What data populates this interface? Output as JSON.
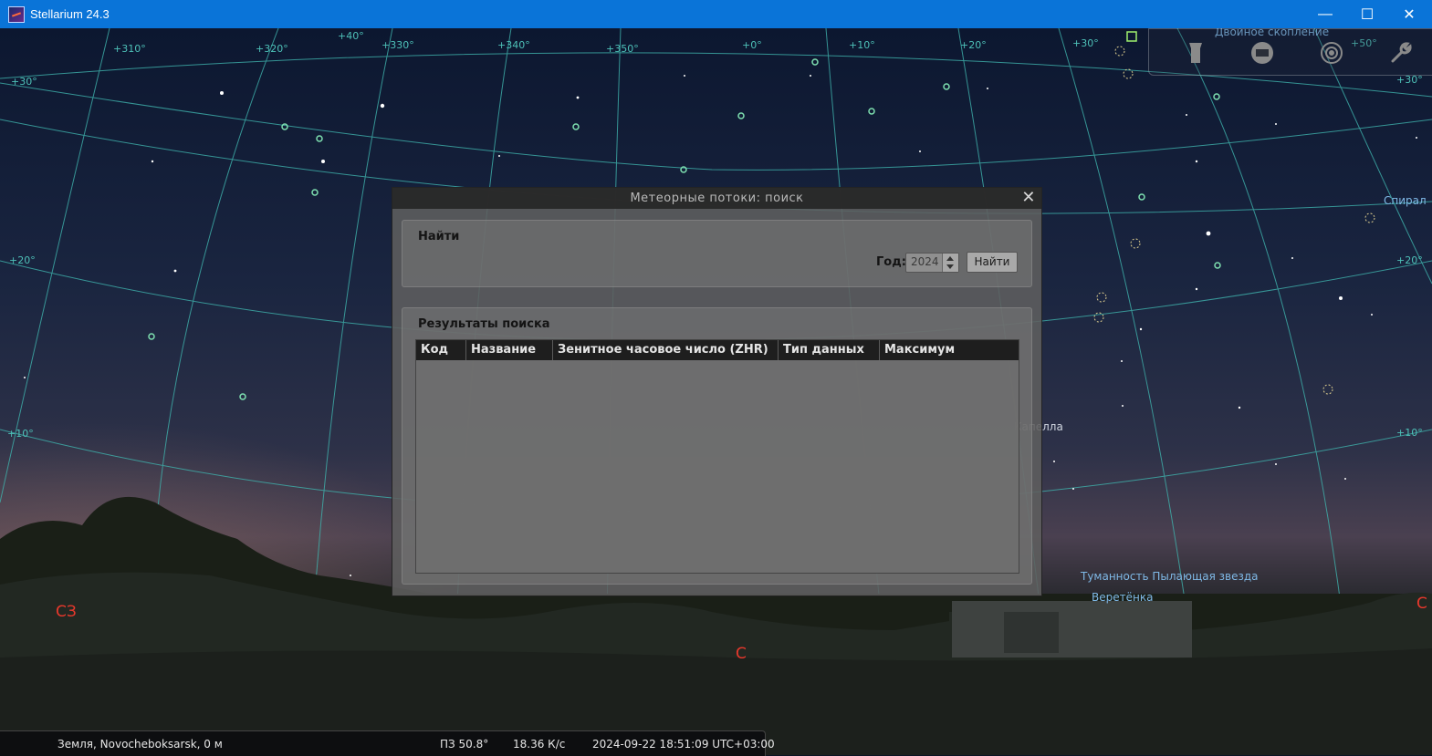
{
  "window": {
    "title": "Stellarium 24.3",
    "minimize": "—",
    "maximize": "☐",
    "close": "✕"
  },
  "sky_labels": {
    "double_cluster": "Двойное скопление",
    "spiral": "Спирал",
    "capella": "Капелла",
    "nebula": "Туманность Пылающая звезда",
    "ghost_label": "Веретёнка",
    "grid": [
      "+310°",
      "+320°",
      "+330°",
      "+340°",
      "+350°",
      "+0°",
      "+10°",
      "+20°",
      "+30°",
      "+40°",
      "+50°",
      "+30°",
      "+20°",
      "+10°",
      "+30°",
      "+20°",
      "+10°",
      "+40°"
    ]
  },
  "compass": {
    "nw": "СЗ",
    "n": "С",
    "ne": "С"
  },
  "toolbar": {
    "icons": [
      "flashlight-icon",
      "screen-icon",
      "target-icon",
      "wrench-icon"
    ]
  },
  "dialog": {
    "title": "Метеорные потоки: поиск",
    "close": "✕",
    "find_group": "Найти",
    "year_label": "Год:",
    "year_value": "2024",
    "find_button": "Найти",
    "results_group": "Результаты поиска",
    "columns": [
      "Код",
      "Название",
      "Зенитное часовое число (ZHR)",
      "Тип данных",
      "Максимум"
    ]
  },
  "statusbar": {
    "location": "Земля, Novocheboksarsk, 0 м",
    "azimuth": "ПЗ 50.8°",
    "fps": "18.36 К/с",
    "datetime": "2024-09-22 18:51:09 UTC+03:00"
  },
  "colors": {
    "titlebar": "#0a74d8",
    "grid": "#3fb3ad",
    "compass": "#e8382c",
    "label": "#7fb8e6"
  }
}
